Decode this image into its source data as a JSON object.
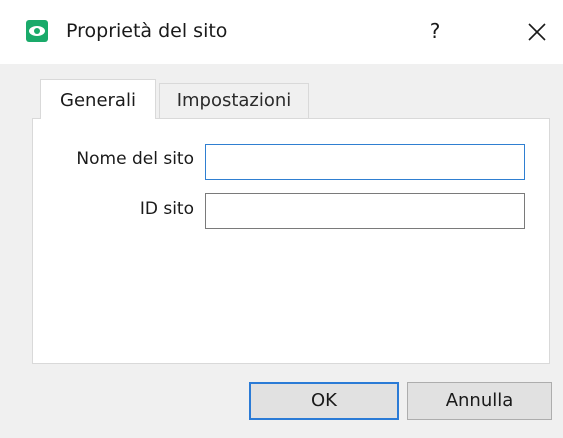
{
  "window": {
    "title": "Proprietà del sito",
    "help_label": "?",
    "icon": "eye-app-icon",
    "accent_color": "#1aaa6a"
  },
  "tabs": [
    {
      "label": "Generali",
      "active": true
    },
    {
      "label": "Impostazioni",
      "active": false
    }
  ],
  "form": {
    "site_name": {
      "label": "Nome del sito",
      "value": ""
    },
    "site_id": {
      "label": "ID sito",
      "value": ""
    }
  },
  "buttons": {
    "ok_label": "OK",
    "cancel_label": "Annulla"
  },
  "focus_color": "#2f7fd1"
}
